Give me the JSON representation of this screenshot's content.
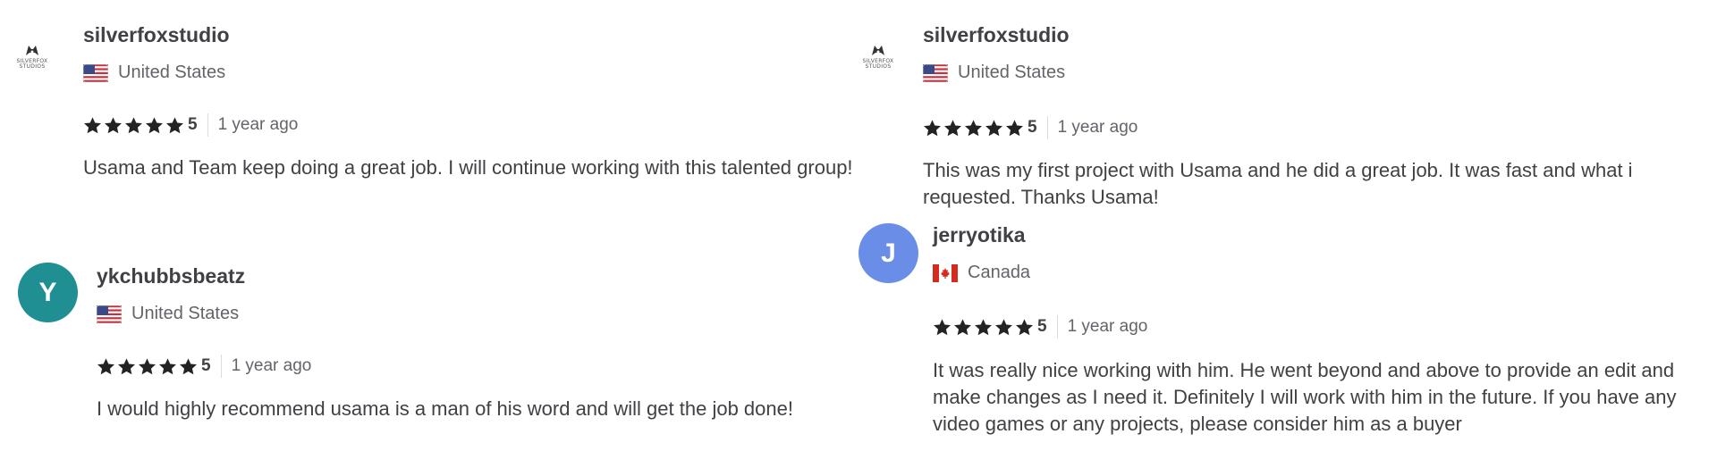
{
  "reviews": [
    {
      "username": "silverfoxstudio",
      "country": "United States",
      "avatar_type": "logo",
      "logo_text": [
        "SILVERFOX",
        "STUDIOS"
      ],
      "rating": "5",
      "time": "1 year ago",
      "comment": "Usama and Team keep doing a great job. I will continue working with this talented group!"
    },
    {
      "username": "ykchubbsbeatz",
      "country": "United States",
      "avatar_type": "letter",
      "avatar_letter": "Y",
      "avatar_color": "#1f8f94",
      "rating": "5",
      "time": "1 year ago",
      "comment": "I would highly recommend usama is a man of his word and will get the job done!"
    },
    {
      "username": "silverfoxstudio",
      "country": "United States",
      "avatar_type": "logo",
      "logo_text": [
        "SILVERFOX",
        "STUDIOS"
      ],
      "rating": "5",
      "time": "1 year ago",
      "comment": "This was my first project with Usama and he did a great job. It was fast and what i requested. Thanks Usama!"
    },
    {
      "username": "jerryotika",
      "country": "Canada",
      "avatar_type": "letter",
      "avatar_letter": "J",
      "avatar_color": "#6a8ee8",
      "rating": "5",
      "time": "1 year ago",
      "comment": "It was really nice working with him. He went beyond and above to provide an edit and make changes as I need it. Definitely I will work with him in the future. If you have any video games or any projects, please consider him as a buyer"
    }
  ],
  "colors": {
    "star": "#222325",
    "text": "#404145",
    "muted": "#62646a"
  },
  "icons": {
    "star": "star-icon",
    "us_flag": "us-flag-icon",
    "ca_flag": "canada-flag-icon"
  }
}
